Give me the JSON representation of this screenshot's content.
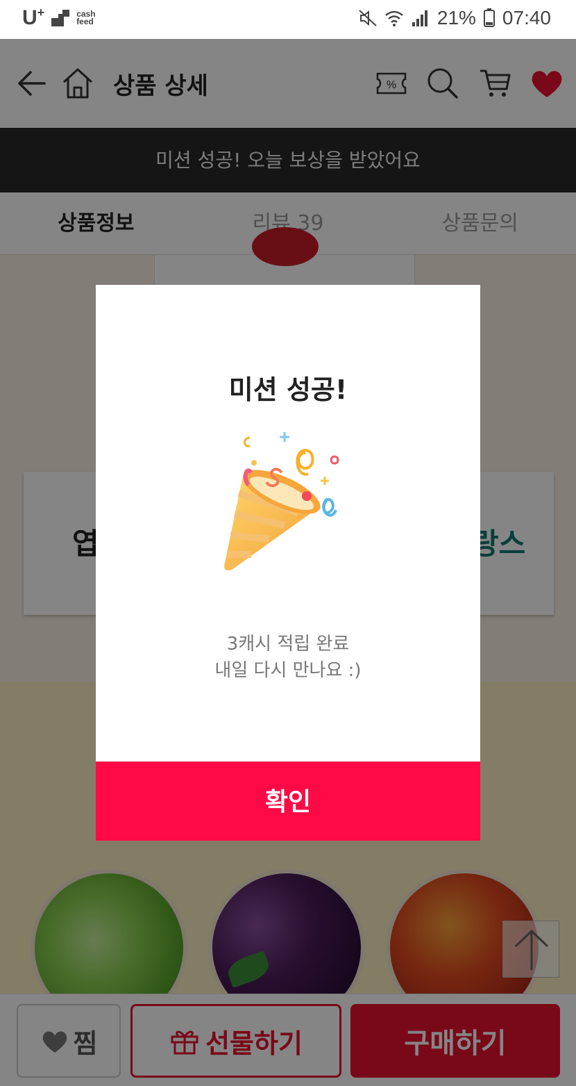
{
  "status_bar": {
    "carrier": "U",
    "carrier_plus": "+",
    "cashfeed_line1": "cash",
    "cashfeed_line2": "feed",
    "battery": "21%",
    "time": "07:40"
  },
  "header": {
    "title": "상품 상세",
    "icons": [
      "back-arrow-icon",
      "home-icon",
      "coupon-percent-icon",
      "search-icon",
      "cart-icon",
      "heart-icon"
    ]
  },
  "banner": {
    "text": "미션 성공! 오늘 보상을 받았어요"
  },
  "tabs": [
    {
      "label": "상품정보",
      "active": true
    },
    {
      "label": "리뷰 39",
      "active": false
    },
    {
      "label": "상품문의",
      "active": false
    }
  ],
  "background_cards": {
    "left_text": "엽",
    "right_text": "랑스"
  },
  "modal": {
    "title": "미션 성공!",
    "line1": "3캐시 적립 완료",
    "line2": "내일 다시 만나요 :)",
    "confirm": "확인"
  },
  "bottom_bar": {
    "zzim": "찜",
    "gift": "선물하기",
    "buy": "구매하기"
  },
  "colors": {
    "accent": "#ff0a46",
    "banner_bg": "#2a2a2a",
    "heart": "#e8102e"
  }
}
